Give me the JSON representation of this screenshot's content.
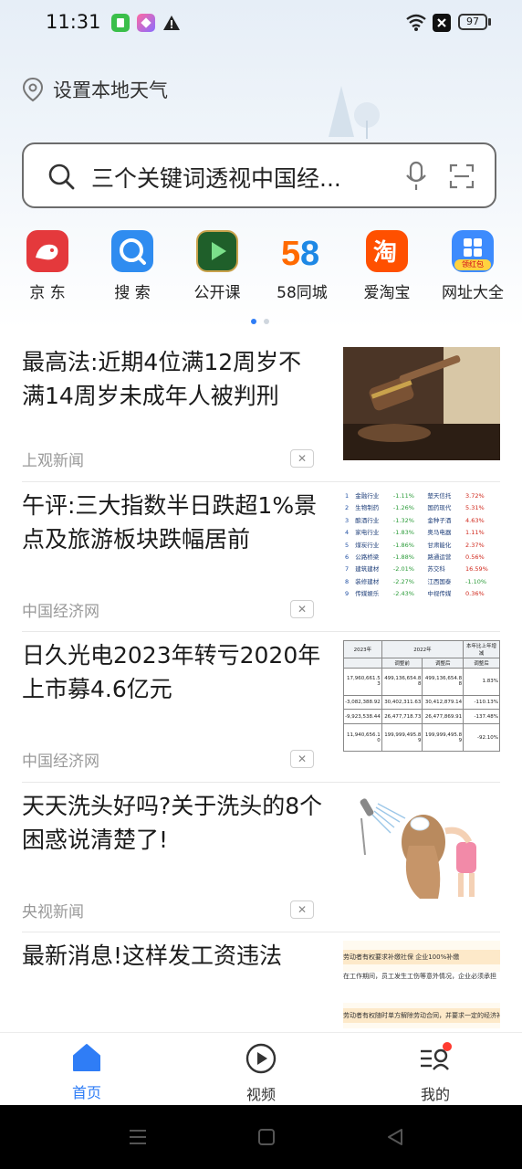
{
  "status": {
    "time": "11:31",
    "battery": "97"
  },
  "weather": {
    "label": "设置本地天气"
  },
  "search": {
    "query": "三个关键词透视中国经..."
  },
  "shortcuts": [
    {
      "label": "京 东",
      "icon": "jd-icon",
      "color": "#e4393c"
    },
    {
      "label": "搜 索",
      "icon": "search-app-icon",
      "color": "#2f8cf0"
    },
    {
      "label": "公开课",
      "icon": "open-class-icon",
      "color": "#2e7d32"
    },
    {
      "label": "58同城",
      "icon": "58-icon",
      "color": "#ff6a00"
    },
    {
      "label": "爱淘宝",
      "icon": "taobao-icon",
      "color": "#ff5000"
    },
    {
      "label": "网址大全",
      "icon": "url-directory-icon",
      "color": "#3d8bfd",
      "badge": "领红包"
    }
  ],
  "feed": [
    {
      "title": "最高法:近期4位满12周岁不满14周岁未成年人被判刑",
      "source": "上观新闻"
    },
    {
      "title": "午评:三大指数半日跌超1%景点及旅游板块跌幅居前",
      "source": "中国经济网"
    },
    {
      "title": "日久光电2023年转亏2020年上市募4.6亿元",
      "source": "中国经济网"
    },
    {
      "title": "天天洗头好吗?关于洗头的8个困惑说清楚了!",
      "source": "央视新闻"
    },
    {
      "title": "最新消息!这样发工资违法",
      "source": ""
    }
  ],
  "stock_table": {
    "rows": [
      {
        "n": "1",
        "sector": "金融行业",
        "chg": "-1.11%",
        "stock": "楚天信托",
        "pct": "3.72%"
      },
      {
        "n": "2",
        "sector": "生物制药",
        "chg": "-1.26%",
        "stock": "国药现代",
        "pct": "5.31%"
      },
      {
        "n": "3",
        "sector": "酿酒行业",
        "chg": "-1.32%",
        "stock": "金种子酒",
        "pct": "4.63%"
      },
      {
        "n": "4",
        "sector": "家电行业",
        "chg": "-1.83%",
        "stock": "奥马电器",
        "pct": "1.11%"
      },
      {
        "n": "5",
        "sector": "煤炭行业",
        "chg": "-1.86%",
        "stock": "甘肃能化",
        "pct": "2.37%"
      },
      {
        "n": "6",
        "sector": "公路桥梁",
        "chg": "-1.88%",
        "stock": "路通运营",
        "pct": "0.56%"
      },
      {
        "n": "7",
        "sector": "建筑建材",
        "chg": "-2.01%",
        "stock": "苏交科",
        "pct": "16.59%"
      },
      {
        "n": "8",
        "sector": "装修建材",
        "chg": "-2.27%",
        "stock": "江西国泰",
        "pct": "-1.10%"
      },
      {
        "n": "9",
        "sector": "传媒娱乐",
        "chg": "-2.43%",
        "stock": "中视传媒",
        "pct": "0.36%"
      }
    ]
  },
  "fin_table": {
    "header": [
      "2023年",
      "",
      "2022年",
      "本年比上年增减"
    ],
    "sub": [
      "",
      "调整前",
      "调整后",
      "调整后"
    ],
    "rows": [
      [
        "17,960,661.53",
        "499,136,654.88",
        "499,136,654.88",
        "1.83%"
      ],
      [
        "-3,082,388.92",
        "30,402,311.63",
        "30,412,879.14",
        "-110.13%"
      ],
      [
        "-9,923,538.44",
        "26,477,718.73",
        "26,477,869.91",
        "-137.48%"
      ],
      [
        "11,940,656.10",
        "199,999,495.89",
        "199,999,495.89",
        "-92.10%"
      ]
    ]
  },
  "wage_article": {
    "lines": [
      "劳动者有权要求补缴社保  企业100%补缴",
      "在工作期间，员工发生工伤等意外情况，企业必须承担",
      "劳动者有权随时单方解除劳动合同，并要求一定的经济补偿"
    ]
  },
  "tabs": [
    {
      "label": "首页",
      "icon": "home-icon"
    },
    {
      "label": "视频",
      "icon": "video-icon"
    },
    {
      "label": "我的",
      "icon": "profile-icon"
    }
  ],
  "colors": {
    "accent": "#2f7df6",
    "notification": "#ff3b30"
  }
}
